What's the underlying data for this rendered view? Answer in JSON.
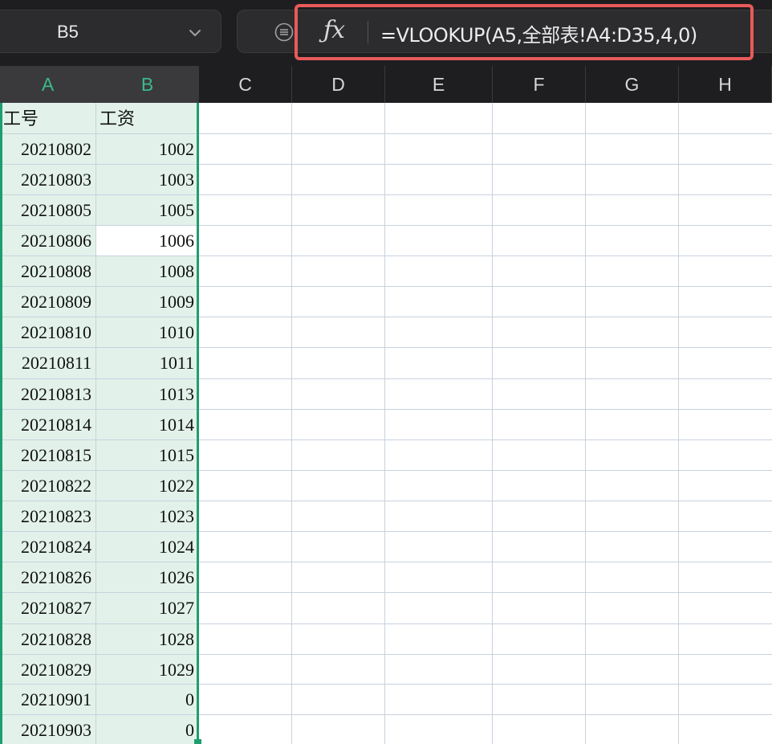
{
  "name_box": {
    "cell_ref": "B5"
  },
  "formula_bar": {
    "fx_label": "ƒx",
    "formula": "=VLOOKUP(A5,全部表!A4:D35,4,0)"
  },
  "columns": [
    {
      "label": "A",
      "selected": true
    },
    {
      "label": "B",
      "selected": true
    },
    {
      "label": "C",
      "selected": false
    },
    {
      "label": "D",
      "selected": false
    },
    {
      "label": "E",
      "selected": false
    },
    {
      "label": "F",
      "selected": false
    },
    {
      "label": "G",
      "selected": false
    },
    {
      "label": "H",
      "selected": false
    }
  ],
  "sheet": {
    "header": {
      "a": "工号",
      "b": "工资"
    },
    "rows": [
      {
        "a": "20210802",
        "b": "1002"
      },
      {
        "a": "20210803",
        "b": "1003"
      },
      {
        "a": "20210805",
        "b": "1005"
      },
      {
        "a": "20210806",
        "b": "1006"
      },
      {
        "a": "20210808",
        "b": "1008"
      },
      {
        "a": "20210809",
        "b": "1009"
      },
      {
        "a": "20210810",
        "b": "1010"
      },
      {
        "a": "20210811",
        "b": "1011"
      },
      {
        "a": "20210813",
        "b": "1013"
      },
      {
        "a": "20210814",
        "b": "1014"
      },
      {
        "a": "20210815",
        "b": "1015"
      },
      {
        "a": "20210822",
        "b": "1022"
      },
      {
        "a": "20210823",
        "b": "1023"
      },
      {
        "a": "20210824",
        "b": "1024"
      },
      {
        "a": "20210826",
        "b": "1026"
      },
      {
        "a": "20210827",
        "b": "1027"
      },
      {
        "a": "20210828",
        "b": "1028"
      },
      {
        "a": "20210829",
        "b": "1029"
      },
      {
        "a": "20210901",
        "b": "0"
      },
      {
        "a": "20210903",
        "b": "0"
      }
    ]
  },
  "colors": {
    "selection_border": "#1e9e6e",
    "selected_header_text": "#3bb98a",
    "selection_fill": "#e2f2ea",
    "formula_highlight": "#e85a5a"
  }
}
